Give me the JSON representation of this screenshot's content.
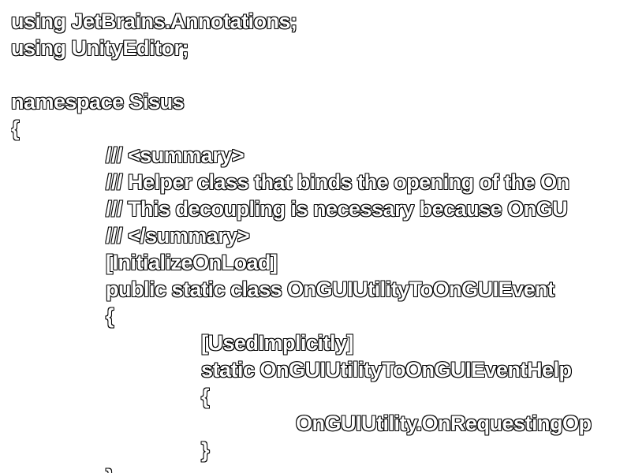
{
  "code_lines": [
    "using JetBrains.Annotations;",
    "using UnityEditor;",
    "",
    "namespace Sisus",
    "{",
    "/// <summary>",
    "/// Helper class that binds the opening of the On",
    "/// This decoupling is necessary because OnGU",
    "/// </summary>",
    "[InitializeOnLoad]",
    "public static class OnGUIUtilityToOnGUIEvent",
    "{",
    "[UsedImplicitly]",
    "static OnGUIUtilityToOnGUIEventHelp",
    "{",
    "OnGUIUtility.OnRequestingOp",
    "}",
    "}"
  ]
}
